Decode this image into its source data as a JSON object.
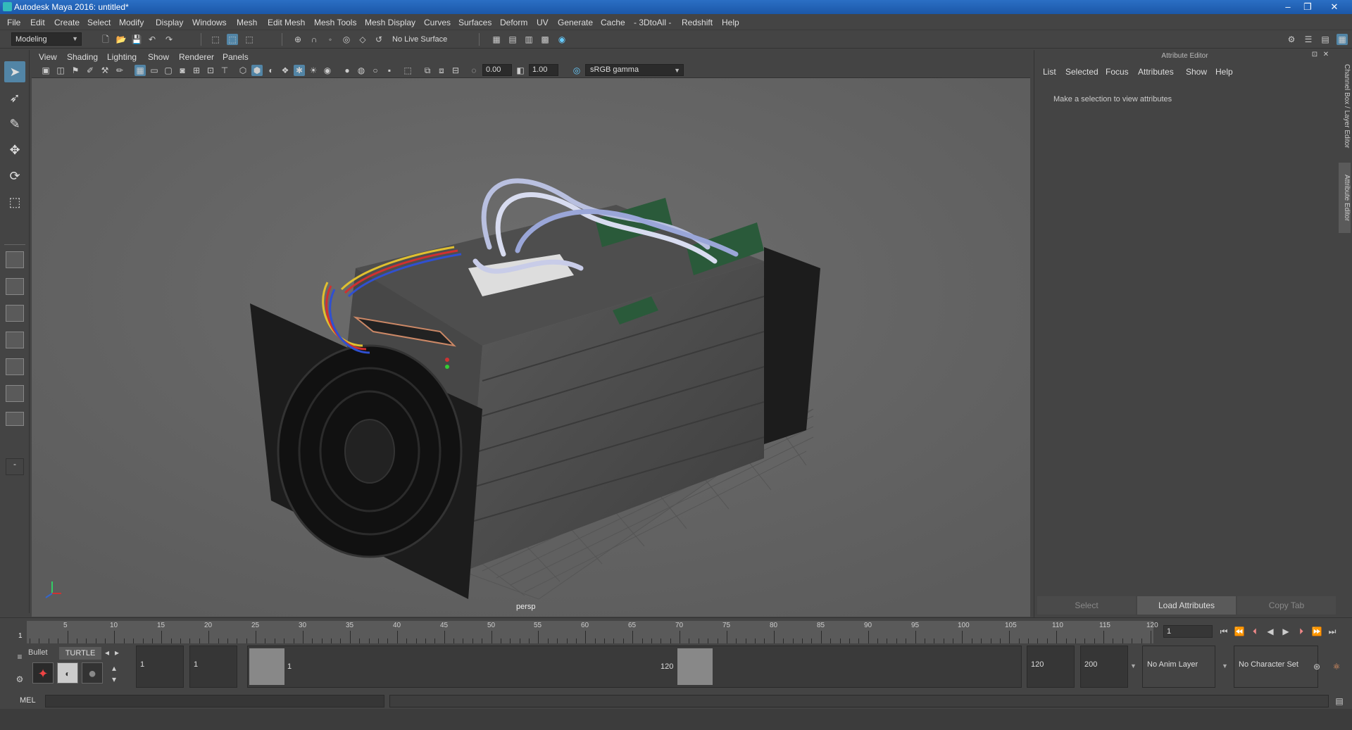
{
  "window": {
    "title": "Autodesk Maya 2016: untitled*"
  },
  "menubar": [
    "File",
    "Edit",
    "Create",
    "Select",
    "Modify",
    "Display",
    "Windows",
    "Mesh",
    "Edit Mesh",
    "Mesh Tools",
    "Mesh Display",
    "Curves",
    "Surfaces",
    "Deform",
    "UV",
    "Generate",
    "Cache",
    "- 3DtoAll -",
    "Redshift",
    "Help"
  ],
  "toolbar": {
    "mode": "Modeling",
    "live_surface": "No Live Surface"
  },
  "viewport": {
    "menu": [
      "View",
      "Shading",
      "Lighting",
      "Show",
      "Renderer",
      "Panels"
    ],
    "exposure": "0.00",
    "gamma": "1.00",
    "colorspace": "sRGB gamma",
    "camera_label": "persp"
  },
  "attribute_editor": {
    "title": "Attribute Editor",
    "menu": [
      "List",
      "Selected",
      "Focus",
      "Attributes",
      "Show",
      "Help"
    ],
    "message": "Make a selection to view attributes",
    "buttons": {
      "select": "Select",
      "load": "Load Attributes",
      "copy": "Copy Tab"
    }
  },
  "side_tabs": {
    "channel": "Channel Box / Layer Editor",
    "attribute": "Attribute Editor"
  },
  "timeline": {
    "ticks": [
      "5",
      "10",
      "15",
      "20",
      "25",
      "30",
      "35",
      "40",
      "45",
      "50",
      "55",
      "60",
      "65",
      "70",
      "75",
      "80",
      "85",
      "90",
      "95",
      "100",
      "105",
      "110",
      "115",
      "120"
    ],
    "start_label": "1",
    "current_frame": "1"
  },
  "range": {
    "start": "1",
    "playback_start": "1",
    "slider_start": "1",
    "slider_end": "120",
    "playback_end": "120",
    "end": "200",
    "anim_layer": "No Anim Layer",
    "character_set": "No Character Set"
  },
  "shelf_tabs": {
    "a": "Bullet",
    "b": "TURTLE"
  },
  "command_line": {
    "lang": "MEL"
  }
}
